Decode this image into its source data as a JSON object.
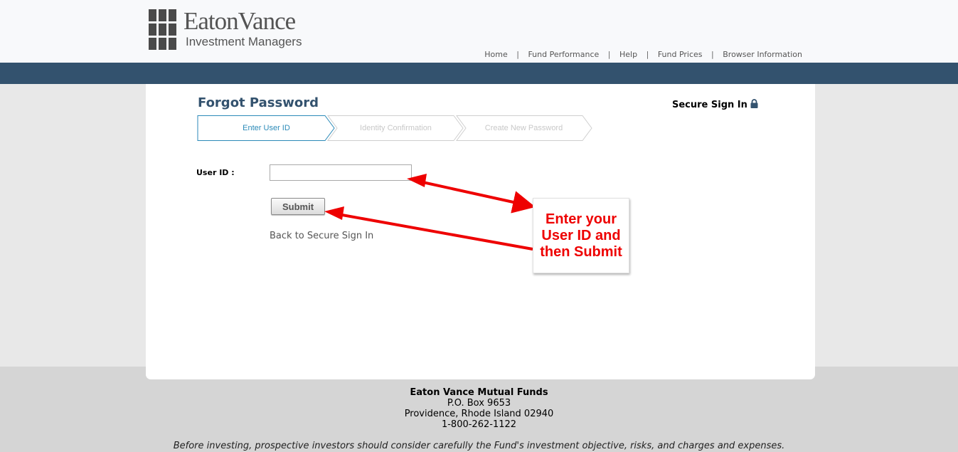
{
  "brand": {
    "name": "EatonVance",
    "subtitle": "Investment Managers"
  },
  "nav": {
    "items": [
      "Home",
      "Fund Performance",
      "Help",
      "Fund Prices",
      "Browser Information"
    ],
    "separator": "|"
  },
  "page": {
    "title": "Forgot Password",
    "secure_label": "Secure Sign In",
    "secure_icon": "lock-icon"
  },
  "steps": [
    {
      "label": "Enter User ID",
      "state": "active"
    },
    {
      "label": "Identity Confirmation",
      "state": "inactive"
    },
    {
      "label": "Create New Password",
      "state": "inactive"
    }
  ],
  "form": {
    "user_id_label": "User ID :",
    "user_id_value": "",
    "submit_label": "Submit",
    "back_link": "Back to Secure Sign In"
  },
  "annotation": {
    "lines": [
      "Enter your",
      "User ID and",
      "then Submit"
    ]
  },
  "footer": {
    "company": "Eaton Vance Mutual Funds",
    "address_lines": [
      "P.O. Box 9653",
      "Providence, Rhode Island 02940",
      "1-800-262-1122"
    ],
    "disclaimer": "Before investing, prospective investors should consider carefully the Fund's investment objective, risks, and charges and expenses."
  },
  "colors": {
    "brand_blue": "#33526e",
    "active_step": "#2b8ab8",
    "annotation_red": "#ee0000"
  }
}
